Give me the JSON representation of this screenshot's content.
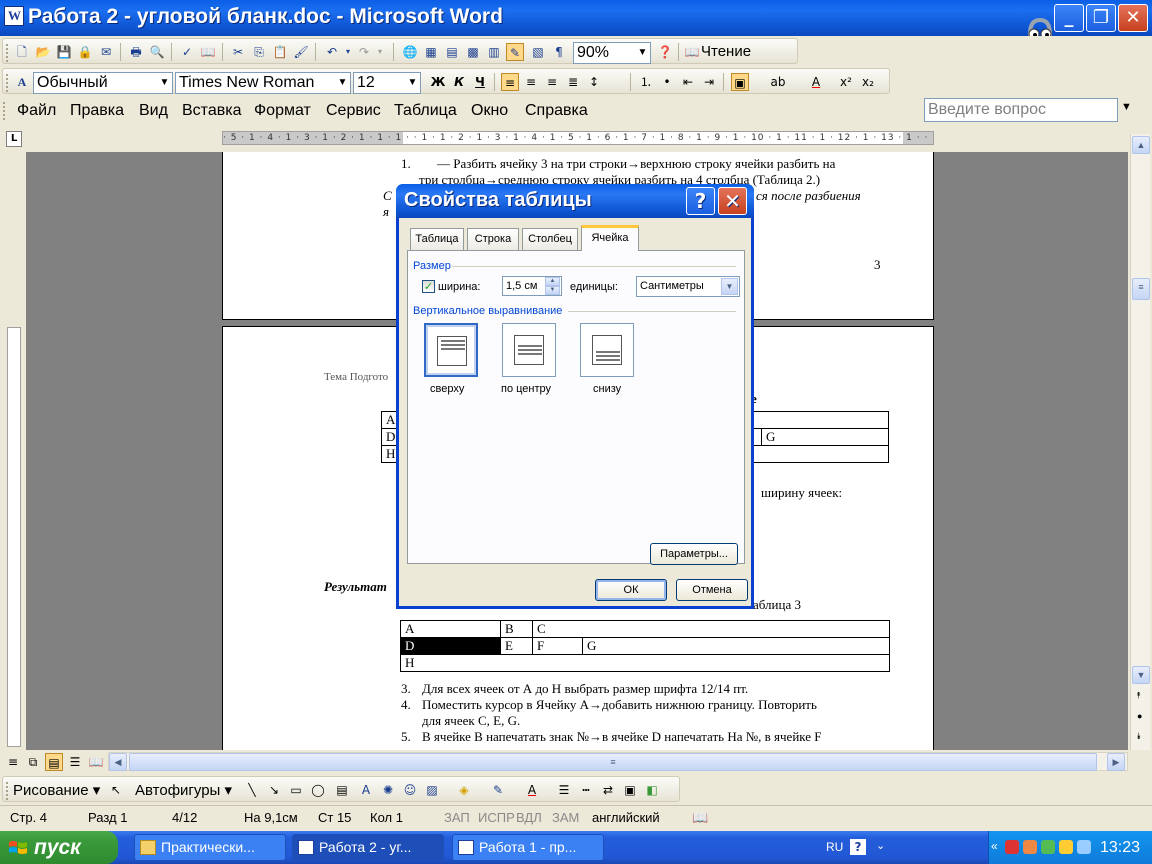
{
  "window": {
    "title": "Работа 2 - угловой бланк.doc - Microsoft Word"
  },
  "toolbar_standard": {
    "zoom": "90%",
    "reading": "Чтение"
  },
  "toolbar_format": {
    "style": "Обычный",
    "font": "Times New Roman",
    "size": "12"
  },
  "menu": {
    "items": [
      "Файл",
      "Правка",
      "Вид",
      "Вставка",
      "Формат",
      "Сервис",
      "Таблица",
      "Окно",
      "Справка"
    ],
    "ask_placeholder": "Введите вопрос"
  },
  "ruler": {
    "text": "· 5 · 1 · 4 · 1 · 3 · 1 · 2 · 1 · 1 · 1 ·   · 1 · 1 · 2 · 1 · 3 · 1 · 4 · 1 · 5 · 1 · 6 · 1 · 7 · 1 · 8 · 1 · 9 · 1 · 10 · 1 · 11 · 1 · 12 · 1 · 13 · 1 ·   · 15 ·"
  },
  "document": {
    "item1_num": "1.",
    "item1_line1": "— Разбить ячейку 3 на три строки→верхнюю строку ячейки разбить на",
    "item1_line2": "три столбца→среднюю строку ячейки разбить на 4 столбца (Таблица 2.)",
    "italic_line": "ся после разбиения",
    "page_number": "3",
    "header_text": "Тема Подгото",
    "bold_fragment": "е",
    "upper_table": {
      "r1": [
        "А",
        ""
      ],
      "r2": [
        "D",
        "",
        "G"
      ],
      "r3": [
        "Н",
        ""
      ]
    },
    "width_text": "ширину ячеек:",
    "result_label": "Результат",
    "table3_caption": "аблица 3",
    "table3": {
      "r1": [
        "A",
        "B",
        "C"
      ],
      "r2": [
        "D",
        "E",
        "F",
        "G"
      ],
      "r3": [
        "H"
      ]
    },
    "item3_num": "3.",
    "item3": "Для всех ячеек  от А до   Н выбрать размер шрифта 12/14 пт.",
    "item4_num": "4.",
    "item4_line1": "Поместить курсор в Ячейку А→добавить нижнюю границу. Повторить",
    "item4_line2": "для ячеек C, E, G.",
    "item5_num": "5.",
    "item5": "В ячейке В напечатать знак №→в ячейке D напечатать  На №, в ячейке F"
  },
  "dialog": {
    "title": "Свойства таблицы",
    "tabs": [
      "Таблица",
      "Строка",
      "Столбец",
      "Ячейка"
    ],
    "size_group": "Размер",
    "width_label": "ширина:",
    "width_value": "1,5 см",
    "units_label": "единицы:",
    "units_value": "Сантиметры",
    "valign_group": "Вертикальное выравнивание",
    "align_top": "сверху",
    "align_center": "по центру",
    "align_bottom": "снизу",
    "params_button": "Параметры...",
    "ok": "ОК",
    "cancel": "Отмена"
  },
  "drawing_toolbar": {
    "draw": "Рисование",
    "autoshapes": "Автофигуры"
  },
  "status": {
    "page": "Стр. 4",
    "section": "Разд 1",
    "pages": "4/12",
    "at": "На 9,1см",
    "line": "Ст 15",
    "col": "Кол 1",
    "rec": "ЗАП",
    "trk": "ИСПР",
    "ext": "ВДЛ",
    "ovr": "ЗАМ",
    "lang": "английский"
  },
  "taskbar": {
    "start": "пуск",
    "tasks": [
      "Практически...",
      "Работа 2 - уг...",
      "Работа 1 - пр..."
    ],
    "lang": "RU",
    "clock": "13:23"
  },
  "colors": {
    "xp_blue": "#0a5fe6",
    "dialog_group": "#0046d5",
    "start_green": "#3a9a3a"
  }
}
